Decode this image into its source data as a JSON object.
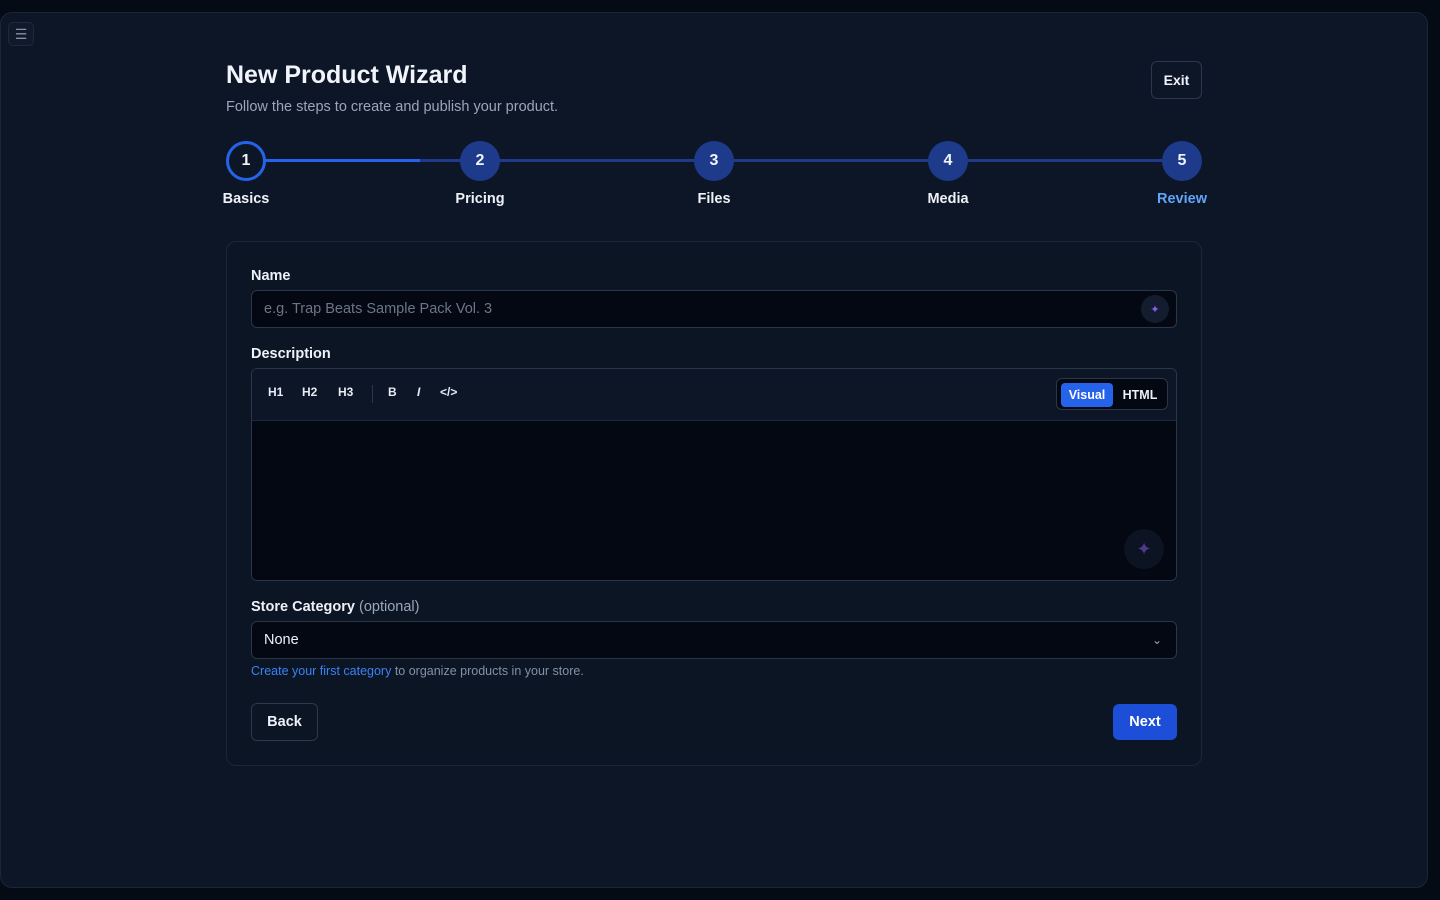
{
  "header": {
    "title": "New Product Wizard",
    "subtitle": "Follow the steps to create and publish your product.",
    "exit_label": "Exit"
  },
  "menu_icon": "hamburger-icon",
  "stepper": {
    "current_step": 1,
    "steps": [
      {
        "number": "1",
        "label": "Basics"
      },
      {
        "number": "2",
        "label": "Pricing"
      },
      {
        "number": "3",
        "label": "Files"
      },
      {
        "number": "4",
        "label": "Media"
      },
      {
        "number": "5",
        "label": "Review"
      }
    ]
  },
  "form": {
    "name": {
      "label": "Name",
      "value": "",
      "placeholder": "e.g. Trap Beats Sample Pack Vol. 3",
      "ai_icon": "sparkle-icon"
    },
    "description": {
      "label": "Description",
      "toolbar": [
        "H1",
        "H2",
        "H3",
        "B",
        "I",
        "</>"
      ],
      "modes": {
        "visual": "Visual",
        "html": "HTML",
        "active": "Visual"
      },
      "value": "",
      "ai_icon": "sparkle-icon"
    },
    "category": {
      "label": "Store Category",
      "optional": "(optional)",
      "selected": "None",
      "help_link": "Create your first category",
      "help_text": " to organize products in your store."
    }
  },
  "actions": {
    "back_label": "Back",
    "next_label": "Next"
  },
  "colors": {
    "accent": "#2563eb",
    "step_inactive": "#1e3a8a",
    "review_label": "#60a5fa",
    "background": "#0d1626"
  }
}
